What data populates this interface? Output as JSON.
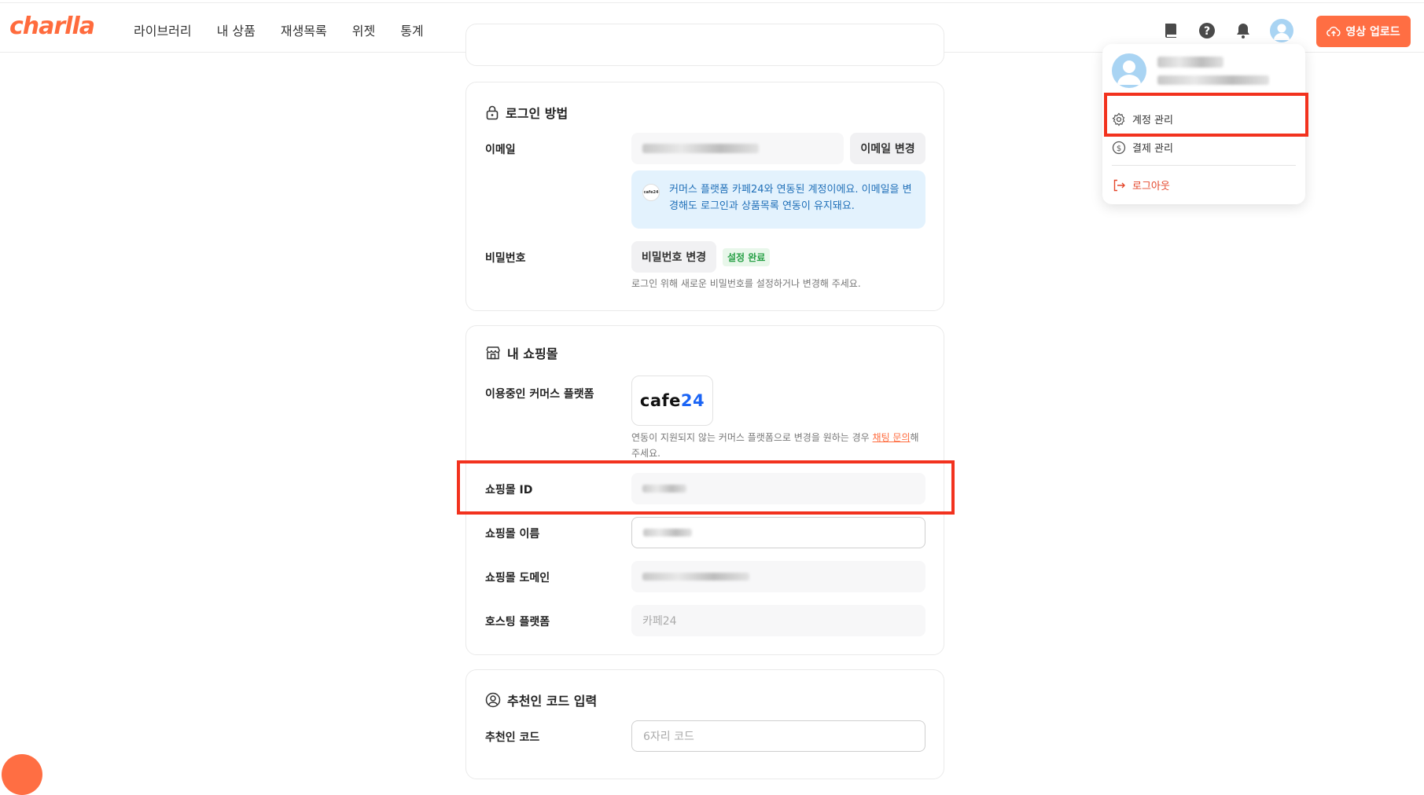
{
  "header": {
    "logo": "charlla",
    "nav": [
      "라이브러리",
      "내 상품",
      "재생목록",
      "위젯",
      "통계"
    ],
    "upload_label": "영상 업로드",
    "icons": [
      "book-icon",
      "help-icon",
      "bell-icon",
      "avatar-icon",
      "cloud-upload-icon"
    ]
  },
  "login_section": {
    "title": "로그인 방법",
    "email_label": "이메일",
    "email_change_label": "이메일 변경",
    "info_logo": "cafe24",
    "info_text": "커머스 플랫폼 카페24와 연동된 계정이에요. 이메일을 변경해도 로그인과 상품목록 연동이 유지돼요.",
    "password_label": "비밀번호",
    "password_change_label": "비밀번호 변경",
    "password_badge": "설정 완료",
    "password_hint": "로그인 위해 새로운 비밀번호를 설정하거나 변경해 주세요."
  },
  "shop_section": {
    "title": "내 쇼핑몰",
    "platform_label": "이용중인 커머스 플랫폼",
    "platform_logo_main": "cafe",
    "platform_logo_num": "24",
    "platform_hint_pre": "연동이 지원되지 않는 커머스 플랫폼으로 변경을 원하는 경우 ",
    "platform_hint_link": "채팅 문의",
    "platform_hint_post": "해주세요.",
    "shop_id_label": "쇼핑몰 ID",
    "shop_name_label": "쇼핑몰 이름",
    "shop_domain_label": "쇼핑몰 도메인",
    "hosting_label": "호스팅 플랫폼",
    "hosting_value": "카페24"
  },
  "referral_section": {
    "title": "추천인 코드 입력",
    "code_label": "추천인 코드",
    "code_placeholder": "6자리 코드"
  },
  "dropdown": {
    "items": [
      "계정 관리",
      "결제 관리",
      "로그아웃"
    ]
  },
  "colors": {
    "brand": "#ff6b3d",
    "highlight": "#f2321e",
    "info_bg": "#e3f2fd",
    "info_text": "#1f6fb8",
    "badge": "#27a046"
  }
}
